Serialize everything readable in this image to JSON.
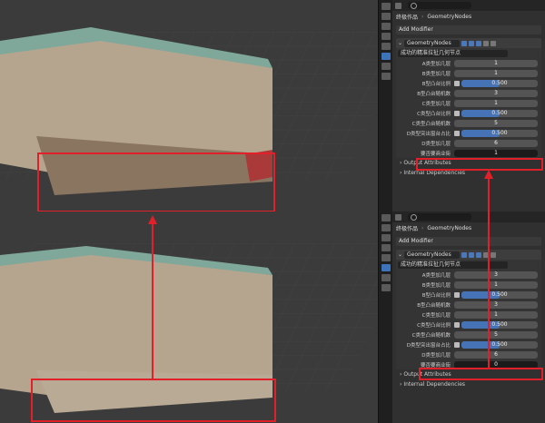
{
  "panel": {
    "crumb_object": "终极作品",
    "crumb_modifier": "GeometryNodes",
    "add_modifier": "Add Modifier",
    "modifier_name": "GeometryNodes",
    "node_group": "成功的精准拉扯几何节点"
  },
  "top_params": [
    {
      "label": "A类型加几层",
      "value": "1",
      "fill": 0
    },
    {
      "label": "B类型加几层",
      "value": "1",
      "fill": 0
    },
    {
      "label": "B型凸台比例",
      "value": "0.500",
      "fill": 0.5,
      "check": true
    },
    {
      "label": "B型凸台随机数",
      "value": "3",
      "fill": 0
    },
    {
      "label": "C类型加几层",
      "value": "1",
      "fill": 0
    },
    {
      "label": "C类型凸台比例",
      "value": "0.500",
      "fill": 0.5,
      "check": true
    },
    {
      "label": "C类型凸台随机数",
      "value": "5",
      "fill": 0
    },
    {
      "label": "D类型突出窗台占比",
      "value": "0.500",
      "fill": 0.5,
      "check": true
    },
    {
      "label": "D类型加几层",
      "value": "6",
      "fill": 0
    },
    {
      "label": "要否要商业街",
      "value": "1",
      "fill": 0,
      "highlight": true
    }
  ],
  "bottom_params": [
    {
      "label": "A类型加几层",
      "value": "3",
      "fill": 0
    },
    {
      "label": "B类型加几层",
      "value": "1",
      "fill": 0
    },
    {
      "label": "B型凸台比例",
      "value": "0.500",
      "fill": 0.5,
      "check": true
    },
    {
      "label": "B型凸台随机数",
      "value": "3",
      "fill": 0
    },
    {
      "label": "C类型加几层",
      "value": "1",
      "fill": 0
    },
    {
      "label": "C类型凸台比例",
      "value": "0.500",
      "fill": 0.5,
      "check": true
    },
    {
      "label": "C类型凸台随机数",
      "value": "5",
      "fill": 0
    },
    {
      "label": "D类型突出窗台占比",
      "value": "0.500",
      "fill": 0.5,
      "check": true
    },
    {
      "label": "D类型加几层",
      "value": "6",
      "fill": 0
    },
    {
      "label": "要否要商业街",
      "value": "0",
      "fill": 0,
      "highlight": true
    }
  ],
  "output_attributes": "Output Attributes",
  "internal_dependencies": "Internal Dependencies",
  "colors": {
    "accent": "#4673b6",
    "annotation": "#e2202a"
  }
}
